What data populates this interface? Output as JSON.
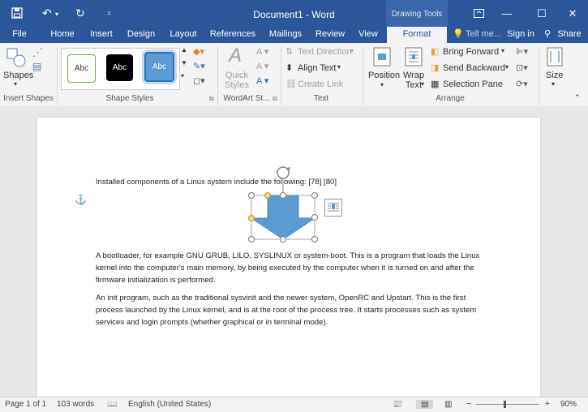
{
  "app": {
    "title": "Document1 - Word",
    "context_tab_group": "Drawing Tools"
  },
  "window_controls": {
    "ribbon_options": "ribbon-display-icon",
    "minimize": "minimize-icon",
    "maximize": "maximize-icon",
    "close": "close-icon"
  },
  "tabs": [
    {
      "label": "File"
    },
    {
      "label": "Home"
    },
    {
      "label": "Insert"
    },
    {
      "label": "Design"
    },
    {
      "label": "Layout"
    },
    {
      "label": "References"
    },
    {
      "label": "Mailings"
    },
    {
      "label": "Review"
    },
    {
      "label": "View"
    },
    {
      "label": "Format",
      "active": true
    }
  ],
  "tell_me": "Tell me...",
  "sign_in": "Sign in",
  "share": "Share",
  "ribbon": {
    "insert_shapes": {
      "shapes_label": "Shapes",
      "group_label": "Insert Shapes"
    },
    "shape_styles": {
      "samples": [
        "Abc",
        "Abc",
        "Abc"
      ],
      "group_label": "Shape Styles"
    },
    "wordart": {
      "quick_styles": "Quick Styles",
      "group_label": "WordArt St..."
    },
    "text": {
      "text_direction": "Text Direction",
      "align_text": "Align Text",
      "create_link": "Create Link",
      "group_label": "Text"
    },
    "arrange": {
      "position": "Position",
      "wrap_text": "Wrap Text",
      "bring_forward": "Bring Forward",
      "send_backward": "Send Backward",
      "selection_pane": "Selection Pane",
      "group_label": "Arrange"
    },
    "size": {
      "label": "Size"
    }
  },
  "document": {
    "paragraphs": [
      "Installed components of a Linux system include the following: [78] [80]",
      "A bootloader, for example GNU GRUB, LILO, SYSLINUX or system-boot. This is a program that loads the Linux kernel into the computer's main memory, by being executed by the computer when it is turned on and after the firmware initialization is performed.",
      "An init program, such as the traditional sysvinit and the newer system, OpenRC and Upstart. This is the first process launched by the Linux kernel, and is at the root of the process tree. It starts processes such as system services and login prompts (whether graphical or in terminal mode)."
    ]
  },
  "status": {
    "page": "Page 1 of 1",
    "words": "103 words",
    "language": "English (United States)",
    "zoom": "90%"
  },
  "colors": {
    "brand": "#2b579a",
    "shape_fill": "#5b9bd5"
  }
}
